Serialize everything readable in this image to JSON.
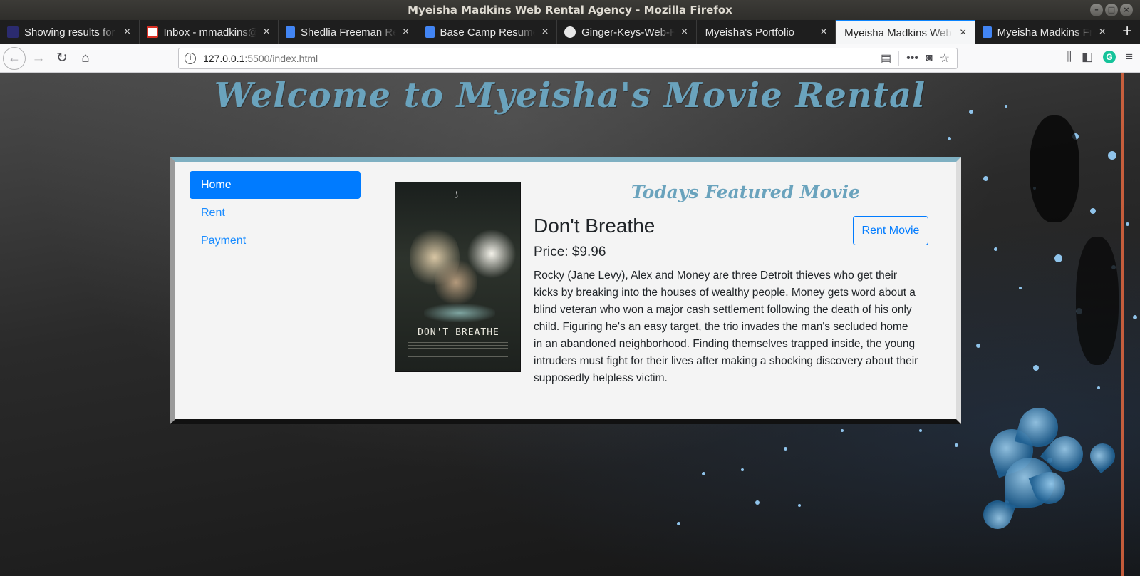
{
  "window": {
    "title": "Myeisha Madkins Web Rental Agency - Mozilla Firefox",
    "controls": [
      "–",
      "□",
      "×"
    ]
  },
  "tabs": [
    {
      "title": "Showing results for",
      "icon": "nu-icon",
      "icon_color": "#2b2b6f",
      "active": false
    },
    {
      "title": "Inbox - mmadkins@",
      "icon": "gmail-icon",
      "icon_color": "#d93025",
      "active": false
    },
    {
      "title": "Shedlia Freeman Re",
      "icon": "google-docs-icon",
      "icon_color": "#4285f4",
      "active": false
    },
    {
      "title": "Base Camp Resume",
      "icon": "google-docs-icon",
      "icon_color": "#4285f4",
      "active": false
    },
    {
      "title": "Ginger-Keys-Web-Re",
      "icon": "github-icon",
      "icon_color": "#e7e7e7",
      "active": false
    },
    {
      "title": "Myeisha's Portfolio",
      "icon": "",
      "icon_color": "",
      "active": false
    },
    {
      "title": "Myeisha Madkins Web R",
      "icon": "",
      "icon_color": "",
      "active": true
    },
    {
      "title": "Myeisha Madkins Fr",
      "icon": "google-docs-icon",
      "icon_color": "#4285f4",
      "active": false
    }
  ],
  "url": {
    "host": "127.0.0.1",
    "path": ":5500/index.html"
  },
  "page": {
    "heading": "Welcome to Myeisha's Movie Rental",
    "nav": [
      {
        "label": "Home",
        "active": true
      },
      {
        "label": "Rent",
        "active": false
      },
      {
        "label": "Payment",
        "active": false
      }
    ],
    "featured_heading": "Todays Featured Movie",
    "movie": {
      "title": "Don't Breathe",
      "price": "Price: $9.96",
      "poster_text": "DON'T BREATHE",
      "description": "Rocky (Jane Levy), Alex and Money are three Detroit thieves who get their kicks by breaking into the houses of wealthy people. Money gets word about a blind veteran who won a major cash settlement following the death of his only child. Figuring he's an easy target, the trio invades the man's secluded home in an abandoned neighborhood. Finding themselves trapped inside, the young intruders must fight for their lives after making a shocking discovery about their supposedly helpless victim.",
      "rent_button": "Rent Movie"
    }
  },
  "colors": {
    "accent": "#007bff",
    "heading": "#6aa3bd",
    "scroll_accent": "#e2673f"
  }
}
